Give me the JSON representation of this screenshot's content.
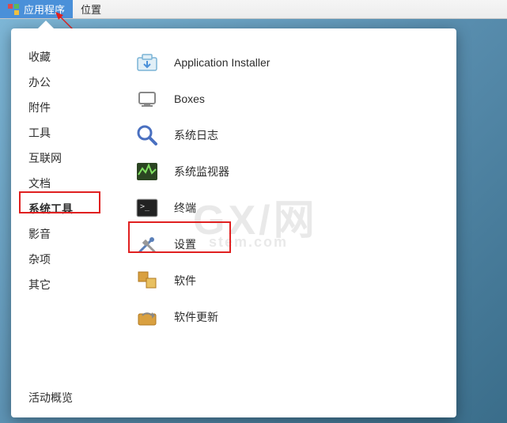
{
  "top_bar": {
    "applications": "应用程序",
    "places": "位置"
  },
  "categories": [
    {
      "key": "favorites",
      "label": "收藏"
    },
    {
      "key": "office",
      "label": "办公"
    },
    {
      "key": "accessories",
      "label": "附件"
    },
    {
      "key": "tools",
      "label": "工具"
    },
    {
      "key": "internet",
      "label": "互联网"
    },
    {
      "key": "documents",
      "label": "文档"
    },
    {
      "key": "system-tools",
      "label": "系统工具",
      "selected": true
    },
    {
      "key": "sound-video",
      "label": "影音"
    },
    {
      "key": "misc",
      "label": "杂项"
    },
    {
      "key": "other",
      "label": "其它"
    }
  ],
  "apps": [
    {
      "key": "app-installer",
      "label": "Application Installer",
      "icon": "app-installer-icon"
    },
    {
      "key": "boxes",
      "label": "Boxes",
      "icon": "boxes-icon"
    },
    {
      "key": "system-logs",
      "label": "系统日志",
      "icon": "logs-icon"
    },
    {
      "key": "system-monitor",
      "label": "系统监视器",
      "icon": "monitor-icon"
    },
    {
      "key": "terminal",
      "label": "终端",
      "icon": "terminal-icon"
    },
    {
      "key": "settings",
      "label": "设置",
      "icon": "settings-icon"
    },
    {
      "key": "software",
      "label": "软件",
      "icon": "software-icon"
    },
    {
      "key": "software-update",
      "label": "软件更新",
      "icon": "software-update-icon"
    }
  ],
  "footer": {
    "overview": "活动概览"
  },
  "watermark": {
    "main": "GX/网",
    "sub": "stem.com"
  }
}
